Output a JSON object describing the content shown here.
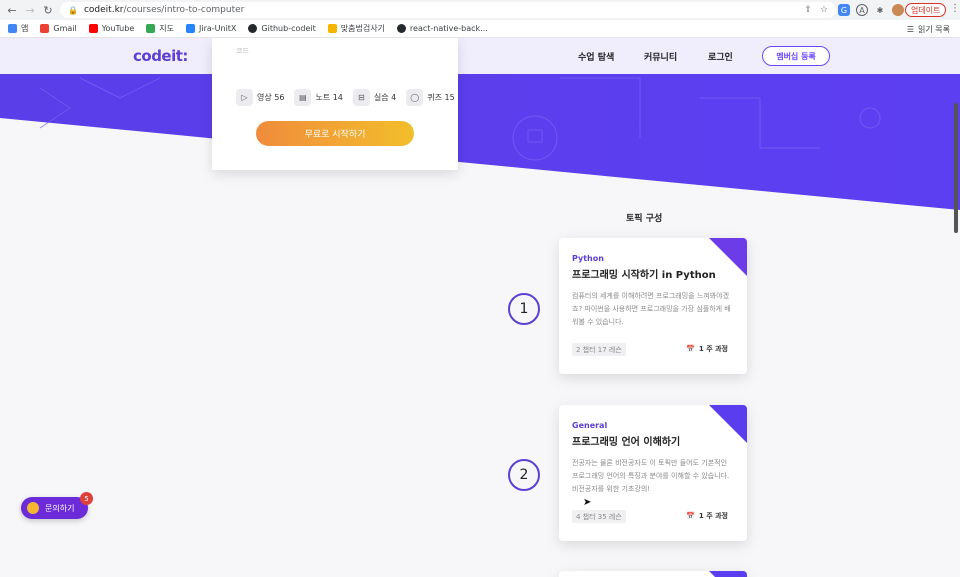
{
  "browser": {
    "url_host": "codeit.kr",
    "url_path": "/courses/intro-to-computer",
    "update_label": "업데이트"
  },
  "bookmarks": [
    {
      "label": "앱",
      "color": "#4285f4"
    },
    {
      "label": "Gmail",
      "color": "#ea4335"
    },
    {
      "label": "YouTube",
      "color": "#ff0000"
    },
    {
      "label": "지도",
      "color": "#34a853"
    },
    {
      "label": "Jira-UnitX",
      "color": "#2684ff"
    },
    {
      "label": "Github-codeit",
      "color": "#24292e"
    },
    {
      "label": "맞춤법검사기",
      "color": "#f4b400"
    },
    {
      "label": "react-native-back...",
      "color": "#24292e"
    }
  ],
  "reading_list": "읽기 목록",
  "header": {
    "logo": "codeit:",
    "nav": [
      "수업 탐색",
      "커뮤니티",
      "로그인"
    ],
    "membership": "멤버십 등록"
  },
  "course_card": {
    "faded_label": "코드",
    "stats": [
      {
        "icon": "play-icon",
        "label": "영상 56"
      },
      {
        "icon": "note-icon",
        "label": "노트 14"
      },
      {
        "icon": "code-icon",
        "label": "실습 4"
      },
      {
        "icon": "quiz-icon",
        "label": "퀴즈 15"
      }
    ],
    "start_label": "무료로 시작하기"
  },
  "topics_title": "토픽 구성",
  "topics": [
    {
      "number": "1",
      "lang": "Python",
      "title": "프로그래밍 시작하기 in Python",
      "desc": "컴퓨터의 세계를 이해하려면 프로그래밍을 느껴봐야겠죠? 파이썬을 사용하면 프로그래밍을 가장 심플하게 배워볼 수 있습니다.",
      "chip": "2 챕터 17 레슨",
      "duration": "1 주 과정",
      "corner_color": "#6c3ce9"
    },
    {
      "number": "2",
      "lang": "General",
      "title": "프로그래밍 언어 이해하기",
      "desc": "전공자는 물론 비전공자도 이 토픽만 들어도 기본적인 프로그래밍 언어의 특징과 분야를 이해할 수 있습니다. 비전공자를 위한 기초강의!",
      "chip": "4 챕터 35 레슨",
      "duration": "1 주 과정",
      "corner_color": "#5b3df0"
    }
  ],
  "chat": {
    "label": "문의하기",
    "badge": "5"
  },
  "colors": {
    "brand": "#5d3fd3",
    "hero": "#5b3df0",
    "start_gradient": [
      "#f08c3c",
      "#f2be2b"
    ]
  }
}
